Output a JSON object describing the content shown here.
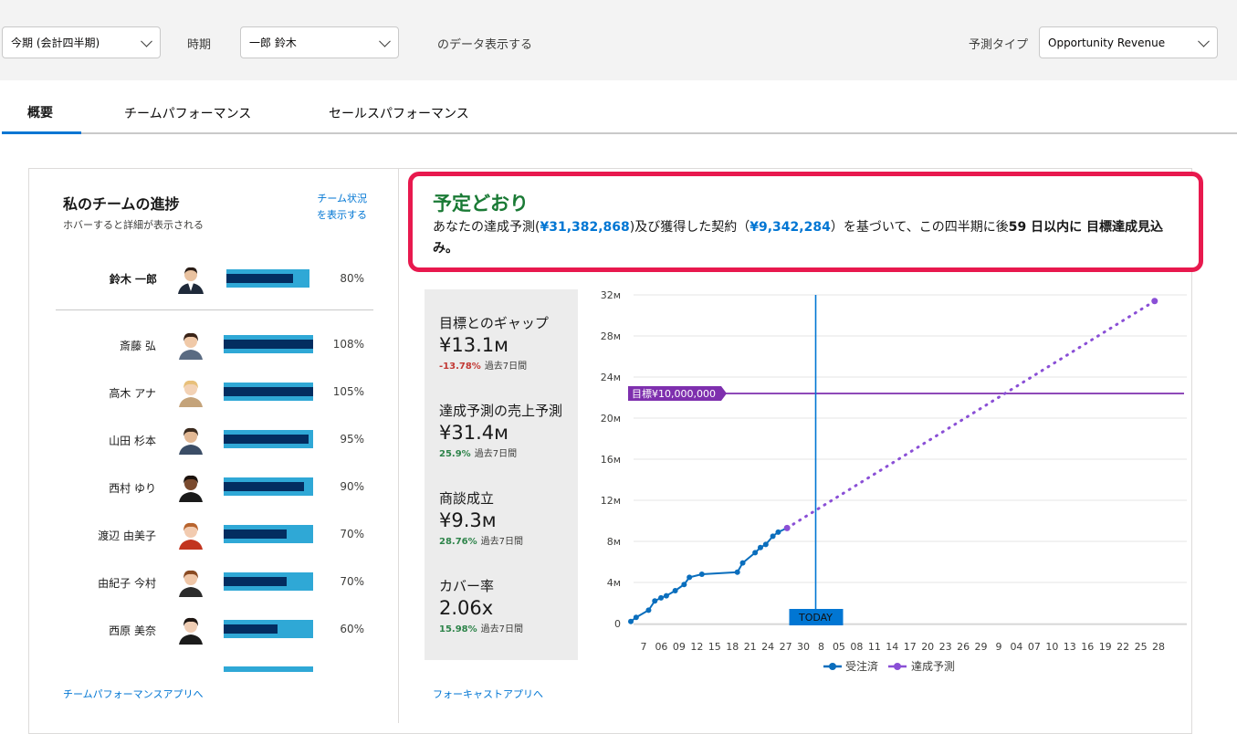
{
  "filters": {
    "period_select": "今期 (会計四半期)",
    "period_label": "時期",
    "user_select": "一郎 鈴木",
    "data_suffix": "のデータ表示する",
    "forecast_type_label": "予測タイプ",
    "forecast_type_select": "Opportunity Revenue"
  },
  "tabs": [
    {
      "label": "概要",
      "active": true
    },
    {
      "label": "チームパフォーマンス",
      "active": false
    },
    {
      "label": "セールスパフォーマンス",
      "active": false
    }
  ],
  "team": {
    "title": "私のチームの進捗",
    "subtitle": "ホバーすると詳細が表示される",
    "status_link_line1": "チーム状況",
    "status_link_line2": "を表示する",
    "leader": {
      "name": "鈴木 一郎",
      "pct": "80%",
      "value": 0.8
    },
    "members": [
      {
        "name": "斎藤 弘",
        "pct": "108%",
        "value": 1.0
      },
      {
        "name": "高木 アナ",
        "pct": "105%",
        "value": 1.0
      },
      {
        "name": "山田 杉本",
        "pct": "95%",
        "value": 0.95
      },
      {
        "name": "西村 ゆり",
        "pct": "90%",
        "value": 0.9
      },
      {
        "name": "渡辺 由美子",
        "pct": "70%",
        "value": 0.7
      },
      {
        "name": "由紀子 今村",
        "pct": "70%",
        "value": 0.7
      },
      {
        "name": "西原 美奈",
        "pct": "60%",
        "value": 0.6
      }
    ],
    "footer_link": "チームパフォーマンスアプリへ"
  },
  "status": {
    "title": "予定どおり",
    "text_1": "あなたの達成予測(",
    "forecast_amount": "¥31,382,868",
    "text_2": ")及び獲得した契約（",
    "won_amount": "¥9,342,284",
    "text_3": "）を基づいて、この四半期に後",
    "days": "59 日以内に 目標達成見込み",
    "text_4": "。"
  },
  "metrics": [
    {
      "label": "目標とのギャップ",
      "value": "¥13.1м",
      "delta": "-13.78%",
      "delta_sign": "neg",
      "period": "過去7日間"
    },
    {
      "label": "達成予測の売上予測",
      "value": "¥31.4м",
      "delta": "25.9%",
      "delta_sign": "pos",
      "period": "過去7日間"
    },
    {
      "label": "商談成立",
      "value": "¥9.3м",
      "delta": "28.76%",
      "delta_sign": "pos",
      "period": "過去7日間"
    },
    {
      "label": "カバー率",
      "value": "2.06x",
      "delta": "15.98%",
      "delta_sign": "pos",
      "period": "過去7日間"
    }
  ],
  "forecast_link": "フォーキャストアプリへ",
  "colors": {
    "won": "#0a6ebd",
    "forecast": "#8a4fd6",
    "target": "#7e2fae",
    "today": "#0176d3",
    "status_border": "#e8194e",
    "status_title": "#1a7a35"
  },
  "chart_data": {
    "type": "line",
    "y_ticks": [
      "0",
      "4м",
      "8м",
      "12м",
      "16м",
      "20м",
      "24м",
      "28м",
      "32м"
    ],
    "ylim": [
      0,
      32000000
    ],
    "x_tick_labels": [
      "7",
      "06",
      "09",
      "12",
      "15",
      "18",
      "21",
      "24",
      "27",
      "30",
      "8",
      "05",
      "08",
      "11",
      "14",
      "17",
      "20",
      "23",
      "26",
      "29",
      "9",
      "04",
      "07",
      "10",
      "13",
      "16",
      "19",
      "22",
      "25",
      "28"
    ],
    "today_label": "TODAY",
    "today_index": 10,
    "target_label": "目標¥10,000,000",
    "target_value": 22400000,
    "series": [
      {
        "name": "受注済",
        "style": "solid",
        "points": [
          [
            0,
            0.2
          ],
          [
            0.3,
            0.6
          ],
          [
            1,
            1.3
          ],
          [
            1.35,
            2.2
          ],
          [
            1.7,
            2.5
          ],
          [
            2,
            2.7
          ],
          [
            2.5,
            3.2
          ],
          [
            3,
            3.8
          ],
          [
            3.3,
            4.5
          ],
          [
            4,
            4.8
          ],
          [
            6,
            5
          ],
          [
            6.3,
            5.9
          ],
          [
            7,
            6.9
          ],
          [
            7.3,
            7.4
          ],
          [
            7.6,
            7.7
          ],
          [
            8,
            8.5
          ],
          [
            8.3,
            8.9
          ],
          [
            8.8,
            9.3
          ]
        ]
      },
      {
        "name": "達成予測",
        "style": "dotted",
        "points": [
          [
            8.8,
            9.3
          ],
          [
            29.5,
            31.4
          ]
        ]
      }
    ],
    "legend": "bottom"
  }
}
